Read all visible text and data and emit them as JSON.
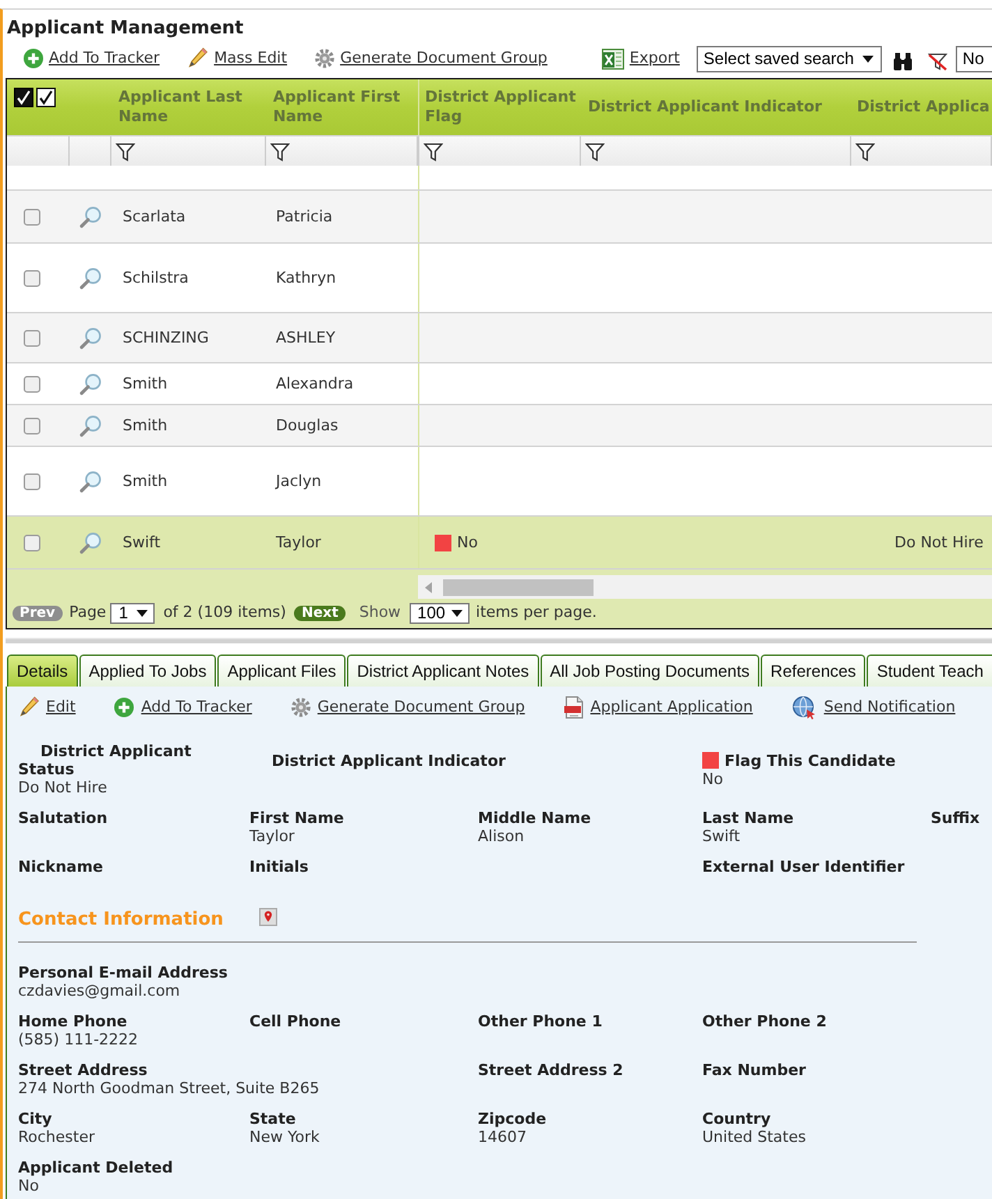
{
  "page": {
    "title": "Applicant Management"
  },
  "toolbar": {
    "actions": [
      {
        "kind": "add",
        "label": "Add To Tracker"
      },
      {
        "kind": "edit",
        "label": "Mass Edit"
      },
      {
        "kind": "generate",
        "label": "Generate Document Group"
      },
      {
        "kind": "export",
        "label": "Export"
      }
    ],
    "saved_search": "Select saved search",
    "search_value": "No"
  },
  "grid": {
    "columns": [
      {
        "label": "Applicant Last Name"
      },
      {
        "label": "Applicant First Name"
      },
      {
        "label": "District Applicant Flag"
      },
      {
        "label": "District Applicant Indicator"
      },
      {
        "label": "District Applica"
      }
    ],
    "rows": [
      {
        "checked": false,
        "selected": false,
        "flag_marker": false,
        "cells": [
          "Scarlata",
          "Patricia",
          null,
          null,
          null
        ]
      },
      {
        "checked": false,
        "selected": false,
        "flag_marker": false,
        "cells": [
          "Schilstra",
          "Kathryn",
          null,
          null,
          null
        ]
      },
      {
        "checked": false,
        "selected": false,
        "flag_marker": false,
        "cells": [
          "SCHINZING",
          "ASHLEY",
          null,
          null,
          null
        ]
      },
      {
        "checked": false,
        "selected": false,
        "flag_marker": false,
        "cells": [
          "Smith",
          "Alexandra",
          null,
          null,
          null
        ]
      },
      {
        "checked": false,
        "selected": false,
        "flag_marker": false,
        "cells": [
          "Smith",
          "Douglas",
          null,
          null,
          null
        ]
      },
      {
        "checked": false,
        "selected": false,
        "flag_marker": false,
        "cells": [
          "Smith",
          "Jaclyn",
          null,
          null,
          null
        ]
      },
      {
        "checked": false,
        "selected": true,
        "flag_marker": true,
        "cells": [
          "Swift",
          "Taylor",
          "No",
          null,
          "Do Not Hire"
        ]
      }
    ]
  },
  "pager": {
    "prev": {
      "label": "Prev",
      "disabled": true
    },
    "page_label": "Page",
    "page": "1",
    "page_count": "of 2 (109 items)",
    "next": {
      "label": "Next",
      "disabled": false
    },
    "show_label": "Show",
    "per_page": "100",
    "per_page_label": "items per page."
  },
  "tabs": [
    {
      "label": "Details",
      "selected": true
    },
    {
      "label": "Applied To Jobs",
      "selected": false
    },
    {
      "label": "Applicant Files",
      "selected": false
    },
    {
      "label": "District Applicant Notes",
      "selected": false
    },
    {
      "label": "All Job Posting Documents",
      "selected": false
    },
    {
      "label": "References",
      "selected": false
    },
    {
      "label": "Student Teach",
      "selected": false
    }
  ],
  "details": {
    "actions": [
      {
        "kind": "edit",
        "label": "Edit"
      },
      {
        "kind": "add",
        "label": "Add To Tracker"
      },
      {
        "kind": "generate",
        "label": "Generate Document Group"
      },
      {
        "kind": "pdf",
        "label": "Applicant Application"
      },
      {
        "kind": "notify",
        "label": "Send Notification"
      }
    ],
    "summary_rows": [
      [
        {
          "label": "District Applicant Status",
          "value": "Do Not Hire",
          "marker": false
        },
        {
          "label": "District Applicant Indicator",
          "marker": false
        },
        null,
        {
          "label": "Flag This Candidate",
          "value": "No",
          "marker": true
        }
      ],
      [
        {
          "label": "Salutation"
        },
        {
          "label": "First Name",
          "value": "Taylor"
        },
        {
          "label": "Middle Name",
          "value": "Alison"
        },
        {
          "label": "Last Name",
          "value": "Swift"
        },
        {
          "label": "Suffix"
        }
      ],
      [
        {
          "label": "Nickname"
        },
        {
          "label": "Initials"
        },
        null,
        {
          "label": "External User Identifier"
        }
      ]
    ],
    "contact": {
      "title": "Contact Information",
      "rows": [
        [
          {
            "label": "Personal E-mail Address",
            "value": "czdavies@gmail.com"
          }
        ],
        [
          {
            "label": "Home Phone",
            "value": "(585) 111-2222"
          },
          {
            "label": "Cell Phone"
          },
          {
            "label": "Other Phone 1"
          },
          {
            "label": "Other Phone 2"
          }
        ],
        [
          {
            "label": "Street Address",
            "value": "274 North Goodman Street, Suite B265"
          },
          null,
          {
            "label": "Street Address 2"
          },
          {
            "label": "Fax Number"
          }
        ],
        [
          {
            "label": "City",
            "value": "Rochester"
          },
          {
            "label": "State",
            "value": "New York"
          },
          {
            "label": "Zipcode",
            "value": "14607"
          },
          {
            "label": "Country",
            "value": "United States"
          }
        ],
        [
          {
            "label": "Applicant Deleted",
            "value": "No"
          }
        ]
      ]
    }
  }
}
